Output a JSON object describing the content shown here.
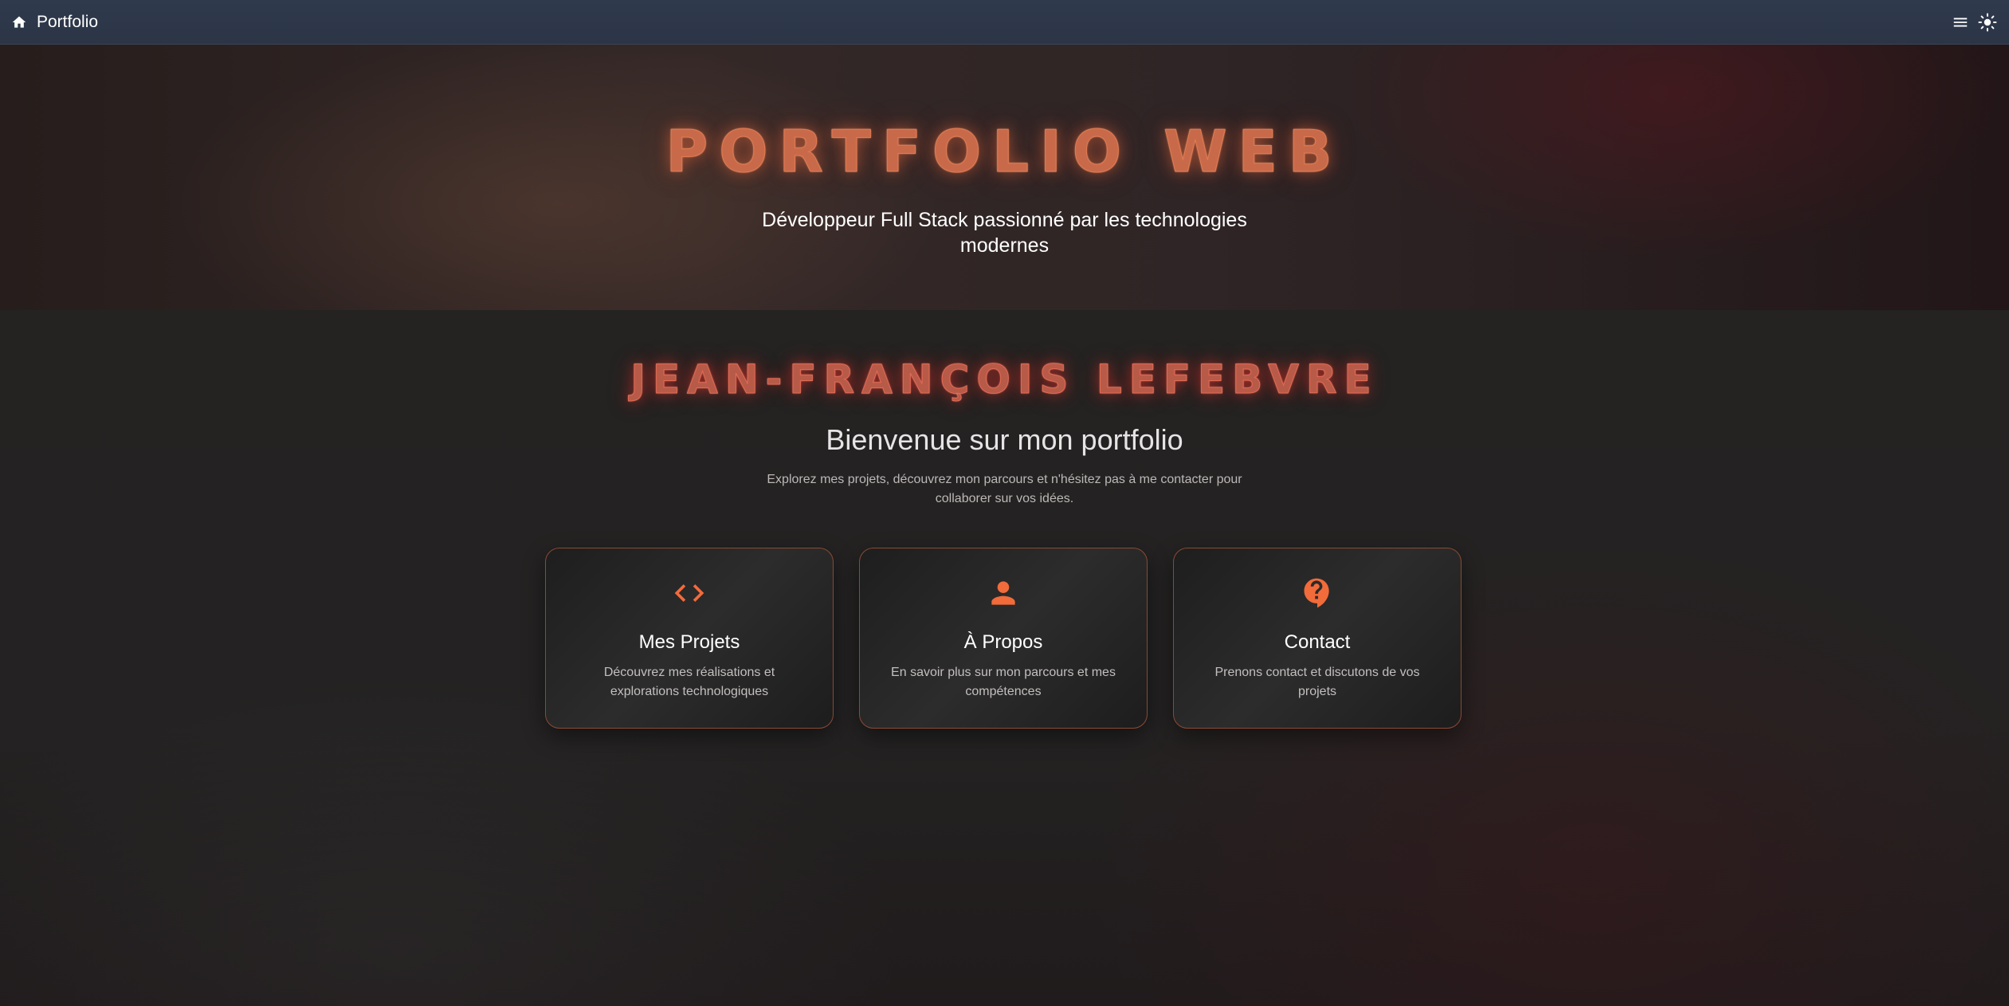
{
  "header": {
    "brand": "Portfolio",
    "home_icon": "home-icon",
    "menu_icon": "menu-icon",
    "theme_icon": "sun-icon"
  },
  "hero": {
    "title": "PORTFOLIO WEB",
    "subtitle": "Développeur Full Stack passionné par les technologies modernes"
  },
  "main": {
    "name": "JEAN-FRANÇOIS LEFEBVRE",
    "welcome": "Bienvenue sur mon portfolio",
    "intro": "Explorez mes projets, découvrez mon parcours et n'hésitez pas à me contacter pour collaborer sur vos idées."
  },
  "cards": [
    {
      "icon": "code-icon",
      "title": "Mes Projets",
      "description": "Découvrez mes réalisations et explorations technologiques"
    },
    {
      "icon": "person-icon",
      "title": "À Propos",
      "description": "En savoir plus sur mon parcours et mes compétences"
    },
    {
      "icon": "question-bubble-icon",
      "title": "Contact",
      "description": "Prenons contact et discutons de vos projets"
    }
  ],
  "colors": {
    "accent": "#f26b3a",
    "card_border": "#8a4a34",
    "header_bg": "#2f3a4d"
  }
}
